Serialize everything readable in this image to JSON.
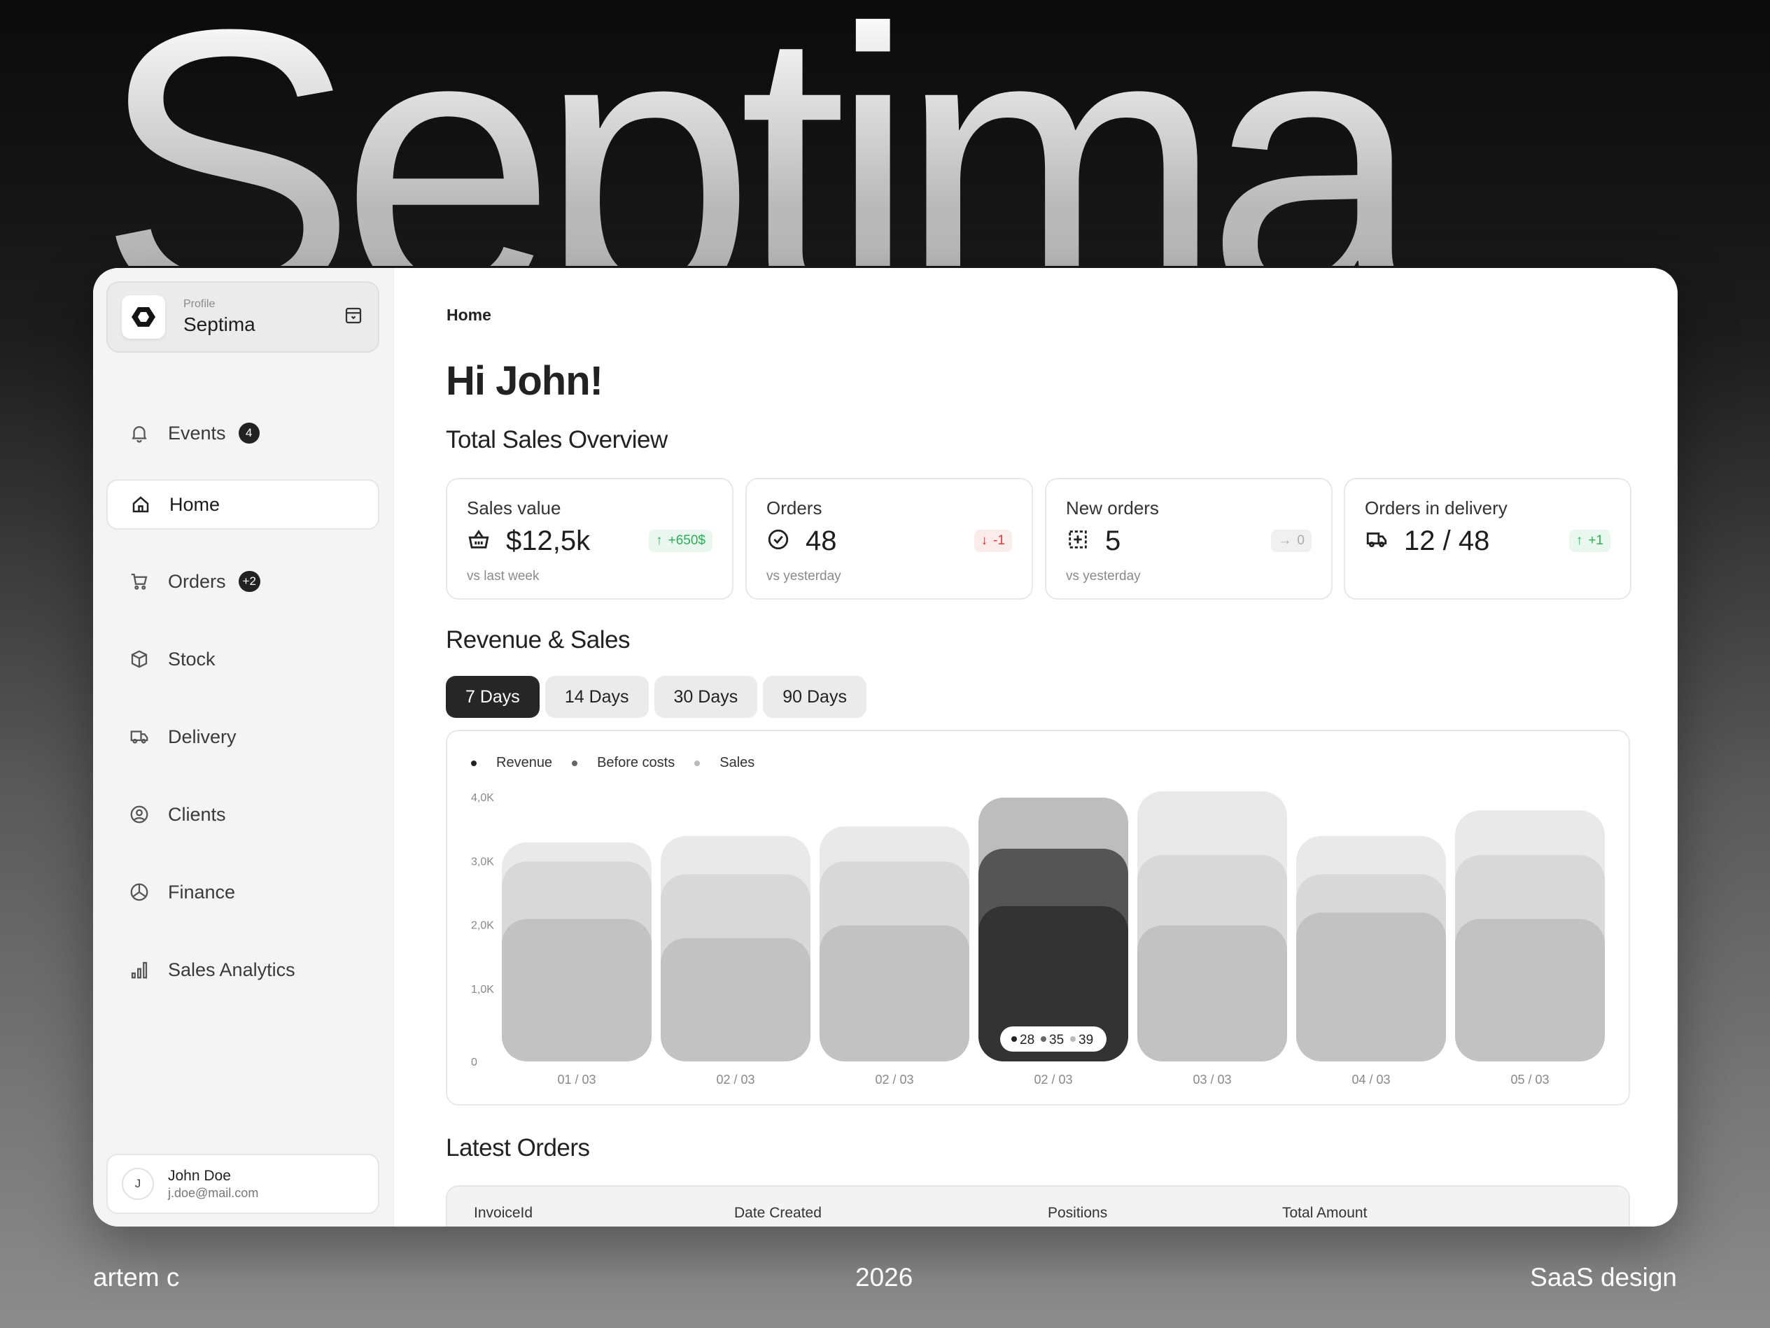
{
  "background_word": "Septima",
  "sidebar": {
    "profile_label": "Profile",
    "profile_name": "Septima",
    "items": [
      {
        "label": "Events",
        "icon": "bell-icon",
        "badge": "4"
      },
      {
        "label": "Home",
        "icon": "home-icon",
        "active": true
      },
      {
        "label": "Orders",
        "icon": "cart-icon",
        "badge": "+2"
      },
      {
        "label": "Stock",
        "icon": "box-icon"
      },
      {
        "label": "Delivery",
        "icon": "truck-icon"
      },
      {
        "label": "Clients",
        "icon": "user-circle-icon"
      },
      {
        "label": "Finance",
        "icon": "pie-chart-icon"
      },
      {
        "label": "Sales Analytics",
        "icon": "bar-chart-icon"
      }
    ],
    "user": {
      "initial": "J",
      "name": "John Doe",
      "email": "j.doe@mail.com"
    }
  },
  "main": {
    "breadcrumb": "Home",
    "greeting": "Hi John!",
    "overview_title": "Total Sales Overview",
    "stats": [
      {
        "title": "Sales value",
        "icon": "basket-icon",
        "value": "$12,5k",
        "delta": "+650$",
        "trend": "up",
        "sub": "vs last week"
      },
      {
        "title": "Orders",
        "icon": "check-circle-icon",
        "value": "48",
        "delta": "-1",
        "trend": "down",
        "sub": "vs yesterday"
      },
      {
        "title": "New orders",
        "icon": "add-box-icon",
        "value": "5",
        "delta": "0",
        "trend": "flat",
        "sub": "vs yesterday"
      },
      {
        "title": "Orders in delivery",
        "icon": "truck-icon",
        "value": "12 / 48",
        "delta": "+1",
        "trend": "up",
        "sub": ""
      }
    ],
    "revenue_title": "Revenue & Sales",
    "tabs": [
      "7 Days",
      "14 Days",
      "30 Days",
      "90 Days"
    ],
    "active_tab": "7 Days",
    "latest_title": "Latest Orders",
    "table_headers": [
      "InvoiceId",
      "Date Created",
      "Positions",
      "Total Amount"
    ]
  },
  "colors": {
    "accent": "#262626",
    "positive": "#2fae55",
    "negative": "#e03a3a",
    "neutral": "#aaaaaa"
  },
  "chart_data": {
    "type": "bar",
    "stacked_overlay": true,
    "categories": [
      "01 / 03",
      "02 / 03",
      "02 / 03",
      "02 / 03",
      "03 / 03",
      "04 / 03",
      "05 / 03"
    ],
    "y_ticks": [
      "0",
      "1,0K",
      "2,0K",
      "3,0K",
      "4,0K"
    ],
    "ylim": [
      0,
      4000
    ],
    "series": [
      {
        "name": "Revenue",
        "color": "#c2c2c2",
        "highlight_color": "#333333",
        "values": [
          2100,
          1800,
          2000,
          2300,
          2000,
          2200,
          2100
        ]
      },
      {
        "name": "Before costs",
        "color": "#d8d8d8",
        "highlight_color": "#555555",
        "values": [
          3000,
          2800,
          3000,
          3200,
          3100,
          2800,
          3100
        ]
      },
      {
        "name": "Sales",
        "color": "#e9e9e9",
        "highlight_color": "#bdbdbd",
        "values": [
          3300,
          3400,
          3550,
          4000,
          4100,
          3400,
          3800
        ]
      }
    ],
    "highlight_index": 3,
    "tooltip": [
      "28",
      "35",
      "39"
    ],
    "legend_position": "top-left",
    "grid": false
  },
  "footer": {
    "author": "artem c",
    "year": "2026",
    "tag": "SaaS design"
  }
}
